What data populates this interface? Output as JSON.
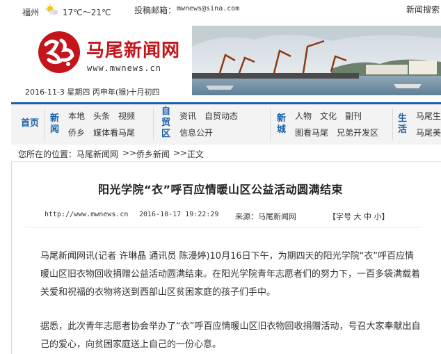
{
  "topbar": {
    "city": "福州",
    "weather_icon": "sun-cloud-icon",
    "temperature": "17℃～21℃",
    "mail_label": "投稿邮箱：",
    "mail_address": "mwnews@sina.com",
    "search_link": "新闻搜索"
  },
  "header": {
    "brand_name": "马尾新闻网",
    "brand_url": "www.mwnews.cn",
    "date_line": "2016-11-3 星期四  丙申年(猴)十月初四",
    "logo_color": "#c4151c"
  },
  "nav": {
    "home": "首页",
    "groups": [
      {
        "title": "新闻",
        "row1": [
          "本地",
          "头条",
          "视频"
        ],
        "row2": [
          "侨乡",
          "媒体看马尾"
        ]
      },
      {
        "title": "自贸区",
        "row1": [
          "资讯",
          "自贸动态"
        ],
        "row2": [
          "信息公开"
        ]
      },
      {
        "title": "新城",
        "row1": [
          "人物",
          "文化",
          "副刊"
        ],
        "row2": [
          "图看马尾",
          "兄弟开发区"
        ]
      },
      {
        "title": "生活",
        "row1": [
          "马尾生"
        ],
        "row2": [
          "马尾美"
        ]
      }
    ],
    "accent_color": "#1a61a8"
  },
  "breadcrumb": {
    "prefix": "您所在的位置：",
    "items": [
      "马尾新闻网",
      "侨乡新闻",
      "正文"
    ],
    "separator": ">>"
  },
  "article": {
    "title": "阳光学院“衣”呼百应情暖山区公益活动圆满结束",
    "url": "http://www.mwnews.cn",
    "datetime": "2016-10-17 19:22:29",
    "source": "来源：马尾新闻网",
    "font_size_label": "【字号 大 中 小】",
    "paragraphs": [
      "马尾新闻网讯(记者 许琳晶 通讯员 陈漫婷)10月16日下午，为期四天的阳光学院“衣”呼百应情暖山区旧衣物回收捐赠公益活动圆满结束。在阳光学院青年志愿者们的努力下，一百多袋满载着关爱和祝福的衣物将送到西部山区贫困家庭的孩子们手中。",
      "据悉，此次青年志愿者协会举办了“衣”呼百应情暖山区旧衣物回收捐赠活动，号召大家奉献出自己的爱心，向贫困家庭送上自己的一份心意。"
    ]
  }
}
